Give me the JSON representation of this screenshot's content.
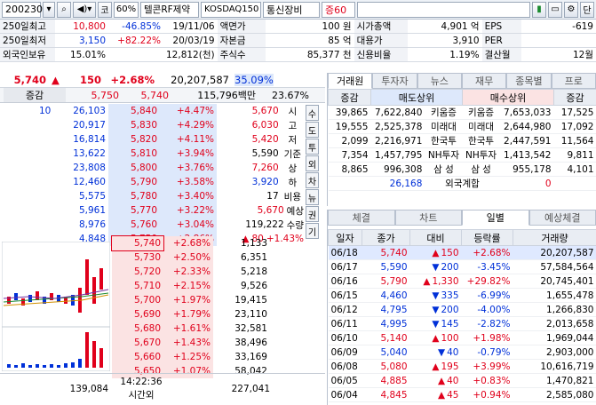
{
  "toolbar": {
    "code": "200230",
    "search_icon": "search-icon",
    "speaker_icon": "speaker-icon",
    "label_ko": "코",
    "margin": "60%",
    "name": "텔콘RF제약",
    "index": "KOSDAQ150",
    "sector": "통신장비",
    "margin_label": "증60"
  },
  "info": [
    {
      "l1": "250일최고",
      "v1": "10,800",
      "p1": "-46.85%",
      "d1": "19/11/06",
      "l2": "액면가",
      "v2": "100 원",
      "l3": "시가총액",
      "v3": "4,901 억",
      "l4": "EPS",
      "v4": "-619"
    },
    {
      "l1": "250일최저",
      "v1": "3,150",
      "p1": "+82.22%",
      "d1": "20/03/19",
      "l2": "자본금",
      "v2": "85 억",
      "l3": "대용가",
      "v3": "3,910",
      "l4": "PER",
      "v4": ""
    },
    {
      "l1": "외국인보유",
      "v1": "15.01%",
      "p1": "",
      "d1": "12,812(천)",
      "l2": "주식수",
      "v2": "85,377 천",
      "l3": "신용비율",
      "v3": "1.19%",
      "l4": "결산월",
      "v4": "12월"
    }
  ],
  "quote": {
    "price": "5,740",
    "change": "150",
    "rate": "+2.68%",
    "volume": "20,207,587",
    "vol_rate": "35.09%"
  },
  "quote2": {
    "label": "증감",
    "p1": "5,750",
    "p2": "5,740",
    "amount": "115,796백만",
    "ratio": "23.67%"
  },
  "asks": [
    {
      "qty": "26,103",
      "price": "5,840",
      "rate": "+4.47%"
    },
    {
      "qty": "20,917",
      "price": "5,830",
      "rate": "+4.29%"
    },
    {
      "qty": "16,814",
      "price": "5,820",
      "rate": "+4.11%"
    },
    {
      "qty": "13,622",
      "price": "5,810",
      "rate": "+3.94%"
    },
    {
      "qty": "23,808",
      "price": "5,800",
      "rate": "+3.76%"
    },
    {
      "qty": "12,460",
      "price": "5,790",
      "rate": "+3.58%"
    },
    {
      "qty": "5,575",
      "price": "5,780",
      "rate": "+3.40%"
    },
    {
      "qty": "5,961",
      "price": "5,770",
      "rate": "+3.22%"
    },
    {
      "qty": "8,976",
      "price": "5,760",
      "rate": "+3.04%"
    },
    {
      "qty": "4,848",
      "price": "5,750",
      "rate": "+2.86%"
    }
  ],
  "ask_first": "10",
  "summary": [
    {
      "v": "5,670",
      "k": "시"
    },
    {
      "v": "6,030",
      "k": "고"
    },
    {
      "v": "5,420",
      "k": "저"
    },
    {
      "v": "5,590",
      "k": "기준"
    },
    {
      "v": "7,260",
      "k": "상"
    },
    {
      "v": "3,920",
      "k": "하"
    },
    {
      "v": "17",
      "k": "비용"
    }
  ],
  "expect": {
    "label": "예상",
    "price": "5,670",
    "qty_label": "수량",
    "qty": "119,222",
    "chg": "80",
    "rate": "+1.43%"
  },
  "bids": [
    {
      "price": "5,740",
      "rate": "+2.68%",
      "qty": "1,133"
    },
    {
      "price": "5,730",
      "rate": "+2.50%",
      "qty": "6,351"
    },
    {
      "price": "5,720",
      "rate": "+2.33%",
      "qty": "5,218"
    },
    {
      "price": "5,710",
      "rate": "+2.15%",
      "qty": "9,526"
    },
    {
      "price": "5,700",
      "rate": "+1.97%",
      "qty": "19,415"
    },
    {
      "price": "5,690",
      "rate": "+1.79%",
      "qty": "23,110"
    },
    {
      "price": "5,680",
      "rate": "+1.61%",
      "qty": "32,581"
    },
    {
      "price": "5,670",
      "rate": "+1.43%",
      "qty": "38,496"
    },
    {
      "price": "5,660",
      "rate": "+1.25%",
      "qty": "33,169"
    },
    {
      "price": "5,650",
      "rate": "+1.07%",
      "qty": "58,042"
    }
  ],
  "side_buttons": [
    "수",
    "도",
    "투",
    "외",
    "차",
    "뉴",
    "권",
    "기"
  ],
  "bottom": {
    "ask_total": "139,084",
    "time": "14:22:36",
    "time_label": "시간외",
    "bid_total": "227,041"
  },
  "broker": {
    "tabs": [
      "거래원",
      "투자자",
      "뉴스",
      "재무",
      "종목별",
      "프로"
    ],
    "headers": [
      "증감",
      "매도상위",
      "매수상위",
      "증감"
    ],
    "rows": [
      {
        "sq": "39,865",
        "sv": "7,622,840",
        "sn": "키움증",
        "bn": "키움증",
        "bv": "7,653,033",
        "bq": "17,525"
      },
      {
        "sq": "19,555",
        "sv": "2,525,378",
        "sn": "미래대",
        "bn": "미래대",
        "bv": "2,644,980",
        "bq": "17,092"
      },
      {
        "sq": "2,099",
        "sv": "2,216,971",
        "sn": "한국투",
        "bn": "한국투",
        "bv": "2,447,591",
        "bq": "11,564"
      },
      {
        "sq": "7,354",
        "sv": "1,457,795",
        "sn": "NH투자",
        "bn": "NH투자",
        "bv": "1,413,542",
        "bq": "9,811"
      },
      {
        "sq": "8,865",
        "sv": "996,308",
        "sn": "삼 성",
        "bn": "삼 성",
        "bv": "955,178",
        "bq": "4,101"
      }
    ],
    "foreign_sell": "26,168",
    "foreign_label": "외국계합",
    "foreign_buy": "0"
  },
  "daily": {
    "tabs": [
      "체결",
      "차트",
      "일별",
      "예상체결"
    ],
    "headers": [
      "일자",
      "종가",
      "대비",
      "등락률",
      "거래량"
    ],
    "rows": [
      {
        "date": "06/18",
        "close": "5,740",
        "dir": "up",
        "chg": "150",
        "rate": "+2.68%",
        "vol": "20,207,587"
      },
      {
        "date": "06/17",
        "close": "5,590",
        "dir": "dn",
        "chg": "200",
        "rate": "-3.45%",
        "vol": "57,584,564"
      },
      {
        "date": "06/16",
        "close": "5,790",
        "dir": "up",
        "chg": "1,330",
        "rate": "+29.82%",
        "vol": "20,745,401"
      },
      {
        "date": "06/15",
        "close": "4,460",
        "dir": "dn",
        "chg": "335",
        "rate": "-6.99%",
        "vol": "1,655,478"
      },
      {
        "date": "06/12",
        "close": "4,795",
        "dir": "dn",
        "chg": "200",
        "rate": "-4.00%",
        "vol": "1,266,830"
      },
      {
        "date": "06/11",
        "close": "4,995",
        "dir": "dn",
        "chg": "145",
        "rate": "-2.82%",
        "vol": "2,013,658"
      },
      {
        "date": "06/10",
        "close": "5,140",
        "dir": "up",
        "chg": "100",
        "rate": "+1.98%",
        "vol": "1,969,044"
      },
      {
        "date": "06/09",
        "close": "5,040",
        "dir": "dn",
        "chg": "40",
        "rate": "-0.79%",
        "vol": "2,903,000"
      },
      {
        "date": "06/08",
        "close": "5,080",
        "dir": "up",
        "chg": "195",
        "rate": "+3.99%",
        "vol": "10,616,719"
      },
      {
        "date": "06/05",
        "close": "4,885",
        "dir": "up",
        "chg": "40",
        "rate": "+0.83%",
        "vol": "1,470,821"
      },
      {
        "date": "06/04",
        "close": "4,845",
        "dir": "up",
        "chg": "45",
        "rate": "+0.94%",
        "vol": "2,585,080"
      }
    ]
  },
  "colors": {
    "up": "#e0001b",
    "down": "#0030d8",
    "ask_bg": "#dde8fb",
    "bid_bg": "#fbe3e3"
  }
}
